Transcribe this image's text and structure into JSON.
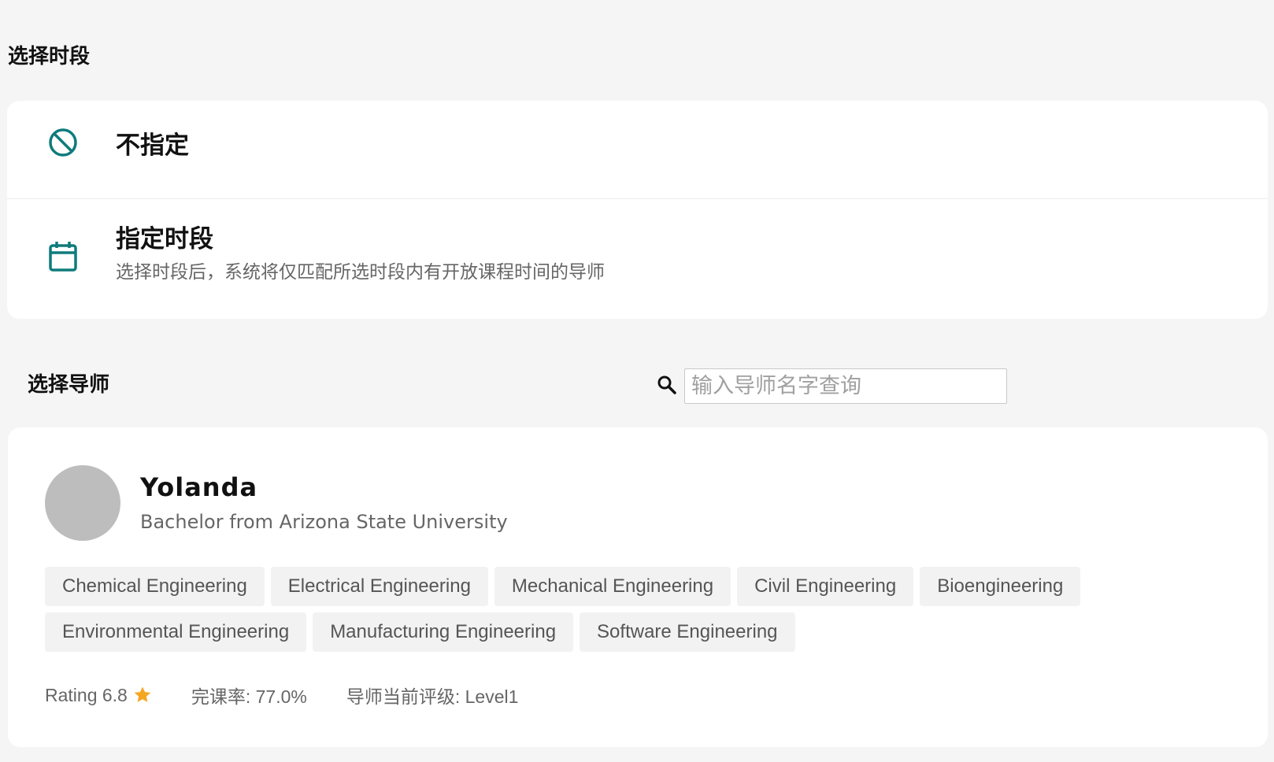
{
  "period_section": {
    "title": "选择时段",
    "options": [
      {
        "icon": "block-icon",
        "label": "不指定"
      },
      {
        "icon": "calendar-icon",
        "label": "指定时段",
        "description": "选择时段后，系统将仅匹配所选时段内有开放课程时间的导师"
      }
    ]
  },
  "tutor_section": {
    "title": "选择导师",
    "search": {
      "icon": "search-icon",
      "placeholder": "输入导师名字查询",
      "value": ""
    }
  },
  "tutor": {
    "name": "Yolanda",
    "education": "Bachelor from Arizona State University",
    "tags": [
      "Chemical Engineering",
      "Electrical Engineering",
      "Mechanical Engineering",
      "Civil Engineering",
      "Bioengineering",
      "Environmental Engineering",
      "Manufacturing Engineering",
      "Software Engineering"
    ],
    "rating_text": "Rating 6.8",
    "completion_text": "完课率: 77.0%",
    "level_text": "导师当前评级: Level1"
  },
  "colors": {
    "accent": "#0f7b7b",
    "star": "#f5a623",
    "background": "#f5f5f5",
    "card": "#ffffff",
    "avatar_placeholder": "#bdbdbd"
  }
}
